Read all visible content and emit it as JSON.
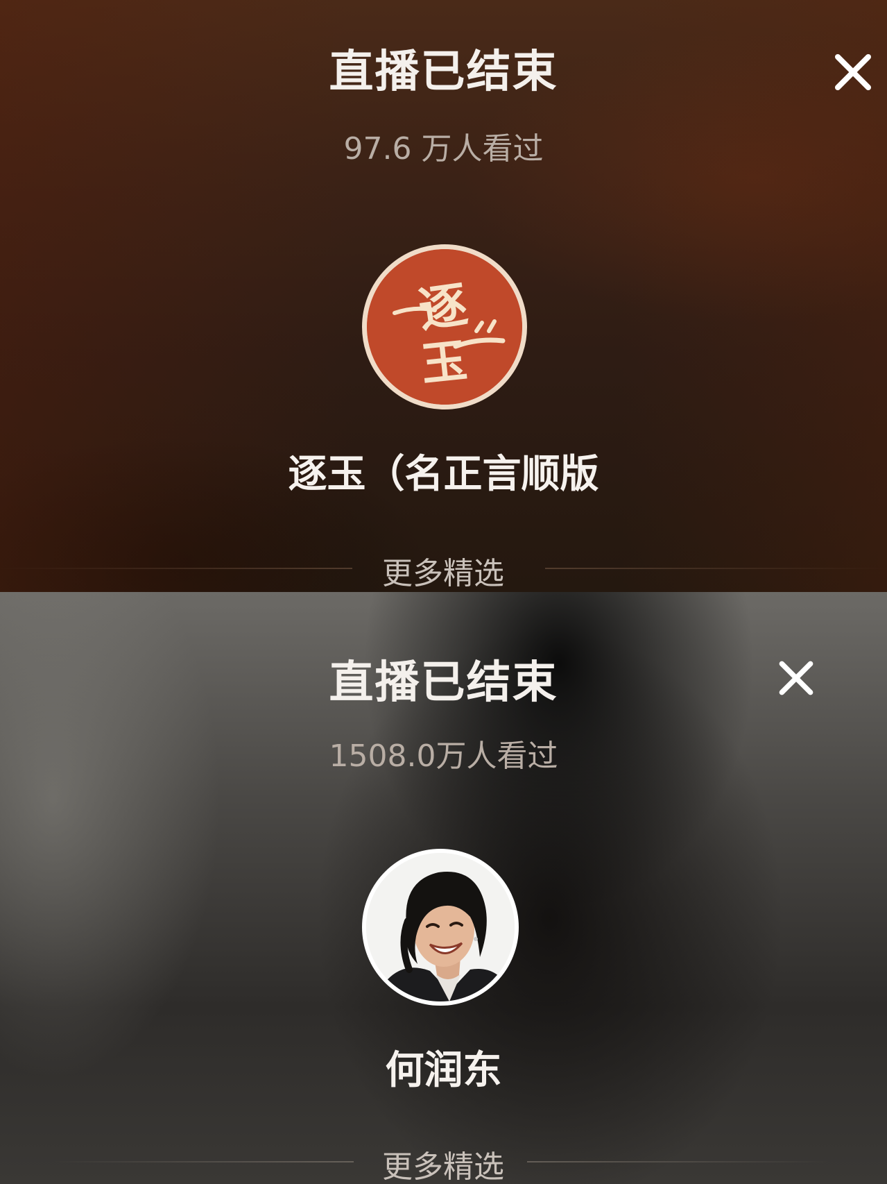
{
  "panels": [
    {
      "title": "直播已结束",
      "views": "97.6 万人看过",
      "streamer_name": "逐玉（名正言顺版",
      "avatar_logo_text": "逐玉",
      "more_label": "更多精选",
      "close_icon": "close-icon"
    },
    {
      "title": "直播已结束",
      "views": "1508.0万人看过",
      "streamer_name": "何润东",
      "avatar_description": "smiling-man-photo",
      "more_label": "更多精选",
      "close_icon": "close-icon"
    }
  ],
  "colors": {
    "logo_red": "#c0492a",
    "logo_ring": "#f0dcc8",
    "text_primary": "#f4f0ec",
    "text_secondary": "#b9aea5"
  }
}
